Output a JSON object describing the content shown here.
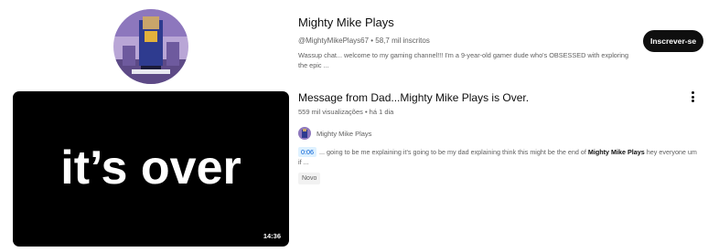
{
  "channel": {
    "name": "Mighty Mike Plays",
    "handle_and_subs": "@MightyMikePlays67 • 58,7 mil inscritos",
    "description": "Wassup chat... welcome to my gaming channel!!! I'm a 9-year-old gamer dude who's OBSESSED with exploring the epic ...",
    "subscribe_label": "Inscrever-se",
    "avatar_icon": "channel-avatar-icon"
  },
  "video": {
    "thumbnail_text": "it’s over",
    "duration": "14:36",
    "title": "Message from Dad...Mighty Mike Plays is Over.",
    "meta": "559 mil visualizações • há 1 dia",
    "channel_name": "Mighty Mike Plays",
    "snippet_timestamp": "0:06",
    "snippet_before": "... going to be me explaining it's going to be my dad explaining think this might be the end of ",
    "snippet_bold": "Mighty Mike Plays",
    "snippet_after": " hey everyone um if ...",
    "badge": "Novo",
    "menu_icon": "more-vert-icon"
  },
  "colors": {
    "subscribe_bg": "#0f0f0f",
    "timestamp_bg": "#def1ff",
    "timestamp_fg": "#065fd4",
    "muted_text": "#606060"
  }
}
